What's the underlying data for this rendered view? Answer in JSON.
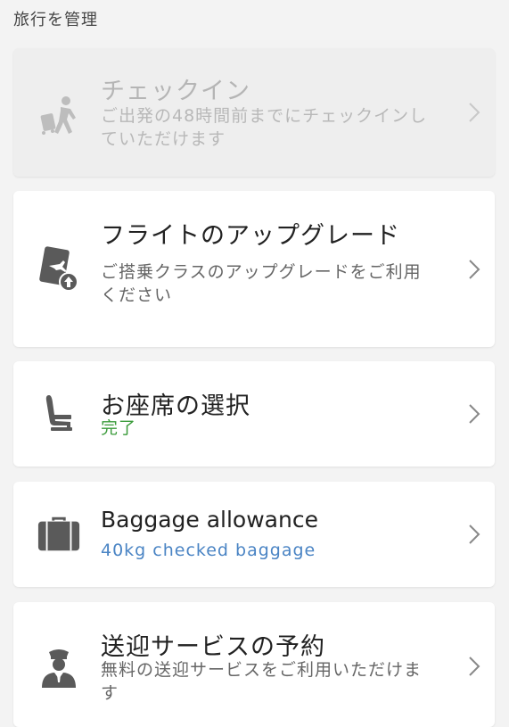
{
  "section": {
    "title": "旅行を管理"
  },
  "cards": [
    {
      "title": "チェックイン",
      "subtitle": "ご出発の48時間前までにチェックインしていただけます",
      "icon": "traveler-icon",
      "state": "disabled"
    },
    {
      "title": "フライトのアップグレード",
      "subtitle": "ご搭乗クラスのアップグレードをご利用ください",
      "icon": "ticket-upgrade-icon"
    },
    {
      "title": "お座席の選択",
      "subtitle": "完了",
      "icon": "seat-icon",
      "subtitle_color": "#3a9b3a"
    },
    {
      "title": "Baggage allowance",
      "subtitle": "40kg checked baggage",
      "icon": "suitcase-icon",
      "subtitle_color": "#4a84c4"
    },
    {
      "title": "送迎サービスの予約",
      "subtitle": "無料の送迎サービスをご利用いただけます",
      "icon": "chauffeur-icon"
    }
  ],
  "colors": {
    "background": "#f3f3f3",
    "card": "#ffffff",
    "disabled_card": "#eeeeee",
    "icon": "#5a5a5a"
  }
}
